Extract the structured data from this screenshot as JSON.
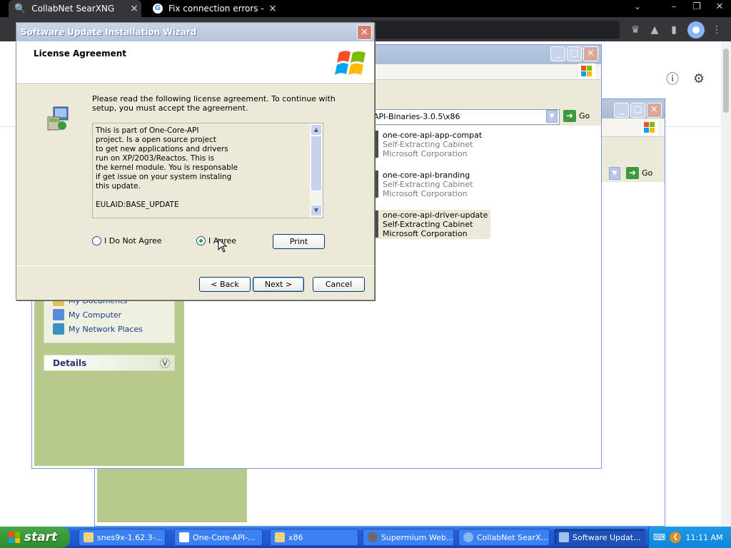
{
  "browser": {
    "tabs": [
      {
        "title": "CollabNet SearXNG",
        "icon": "search-icon"
      },
      {
        "title": "Fix connection errors - Go",
        "icon": "google-icon"
      }
    ],
    "window_controls": {
      "minimize": "–",
      "restore": "❐",
      "close": "✕"
    },
    "tab_menu": "⌄",
    "toolbar_icons": [
      "extensions-icon",
      "pin-icon",
      "sidebar-icon",
      "profile-icon",
      "menu-icon"
    ],
    "menu_glyph": "⋮",
    "page_icons": {
      "info": "ⓘ",
      "settings": "⚙"
    }
  },
  "explorer1": {
    "address": "API-Binaries-3.0.5\\x86",
    "go_label": "Go",
    "items": [
      {
        "name": "one-core-api-app-compat",
        "type": "Self-Extracting Cabinet",
        "company": "Microsoft Corporation"
      },
      {
        "name": "one-core-api-branding",
        "type": "Self-Extracting Cabinet",
        "company": "Microsoft Corporation"
      },
      {
        "name": "one-core-api-driver-update",
        "type": "Self-Extracting Cabinet",
        "company": "Microsoft Corporation"
      }
    ],
    "other_places": [
      "My Documents",
      "My Computer",
      "My Network Places"
    ],
    "details_label": "Details"
  },
  "explorer2": {
    "go_label": "Go"
  },
  "wizard": {
    "title": "Software Update Installation Wizard",
    "header": "License Agreement",
    "instruction": "Please read the following license agreement. To continue with setup, you must accept the agreement.",
    "license_text": "This is part of One-Core-API\nproject. Is a open source project\nto get new applications and drivers\nrun on XP/2003/Reactos. This is\nthe kernel module. You is responsable\nif get issue on your system instaling\nthis update.\n\nEULAID:BASE_UPDATE",
    "disagree_label": "I Do Not Agree",
    "agree_label": "I Agree",
    "selected": "agree",
    "print_label": "Print",
    "back_label": "< Back",
    "next_label": "Next >",
    "cancel_label": "Cancel"
  },
  "taskbar": {
    "start_label": "start",
    "tasks": [
      {
        "label": "snes9x-1.62.3-...",
        "icon": "folder-icon",
        "active": false
      },
      {
        "label": "One-Core-API-...",
        "icon": "document-icon",
        "active": false
      },
      {
        "label": "x86",
        "icon": "folder-icon",
        "active": false
      },
      {
        "label": "Supermium Web...",
        "icon": "browser-icon",
        "active": false
      },
      {
        "label": "CollabNet SearX...",
        "icon": "browser-icon",
        "active": false
      },
      {
        "label": "Software Updat...",
        "icon": "installer-icon",
        "active": true
      }
    ],
    "clock": "11:11 AM"
  },
  "colors": {
    "xp_blue": "#245edb",
    "start_green": "#3c9a3c",
    "explorer_pane": "#b7c98b",
    "dialog_face": "#ece9d8"
  }
}
